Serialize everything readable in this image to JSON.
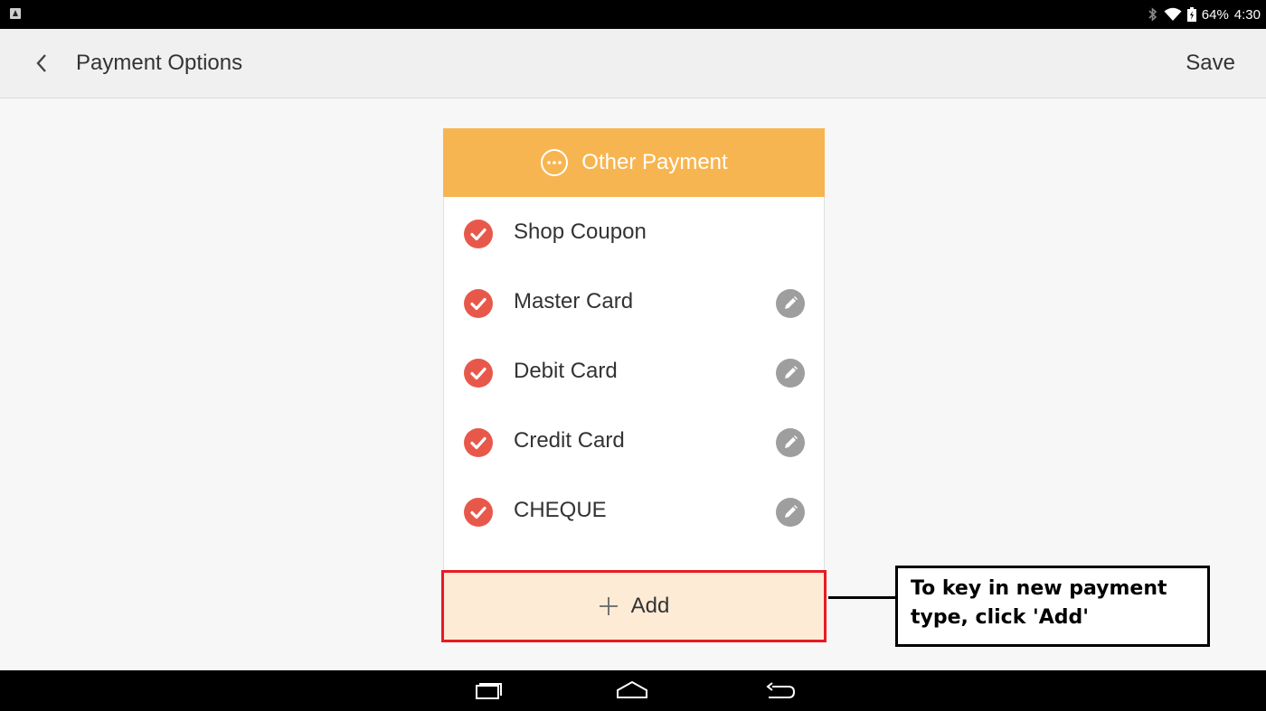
{
  "status_bar": {
    "battery": "64%",
    "time": "4:30"
  },
  "action_bar": {
    "title": "Payment Options",
    "save_label": "Save"
  },
  "card": {
    "header_title": "Other Payment",
    "items": [
      {
        "label": "Shop Coupon",
        "checked": true,
        "editable": false
      },
      {
        "label": "Master Card",
        "checked": true,
        "editable": true
      },
      {
        "label": "Debit Card",
        "checked": true,
        "editable": true
      },
      {
        "label": "Credit Card",
        "checked": true,
        "editable": true
      },
      {
        "label": "CHEQUE",
        "checked": true,
        "editable": true
      }
    ],
    "add_label": "Add"
  },
  "callout": {
    "text": "To key in new payment type, click 'Add'"
  },
  "colors": {
    "header_accent": "#f7b551",
    "check": "#e8584a",
    "add_bg": "#fdebd6",
    "highlight_border": "#e81a24"
  },
  "icons": {
    "status_left": "notification-icon",
    "bluetooth": "bluetooth-icon",
    "wifi": "wifi-icon",
    "battery": "battery-icon",
    "back": "chevron-left-icon",
    "header": "more-horizontal-circle-icon",
    "check": "check-circle-icon",
    "edit": "pencil-icon",
    "add": "plus-icon",
    "nav_recent": "recent-apps-icon",
    "nav_home": "home-icon",
    "nav_back": "back-arrow-icon"
  }
}
